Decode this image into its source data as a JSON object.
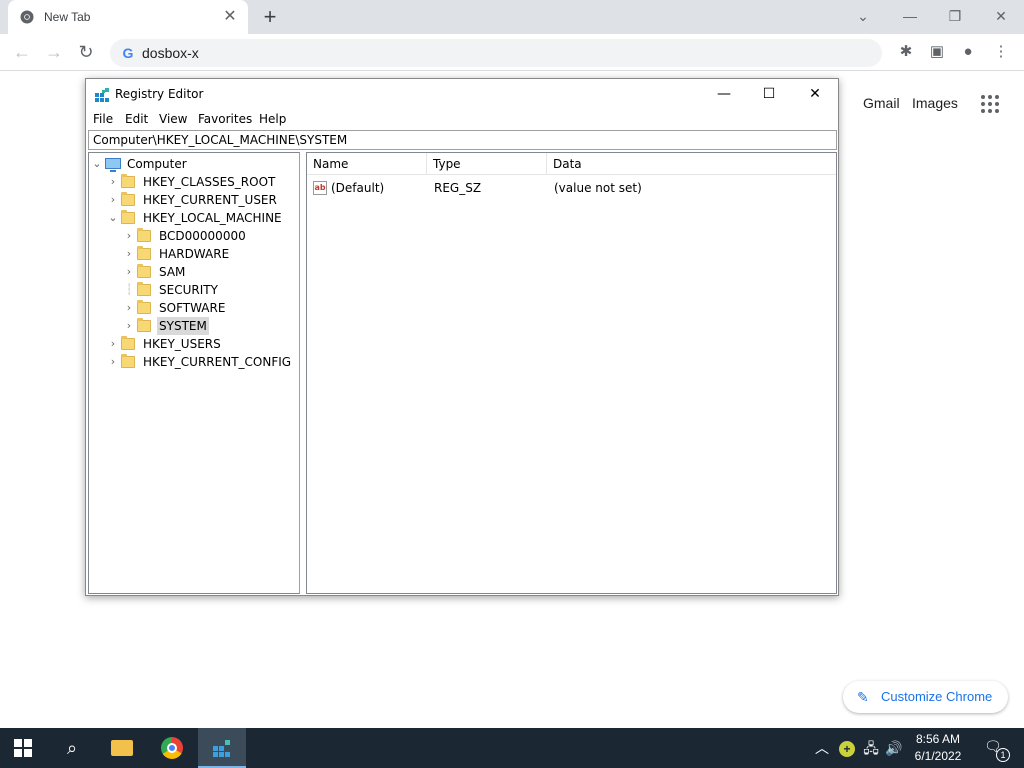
{
  "browser": {
    "tab": {
      "title": "New Tab"
    },
    "url": "dosbox-x"
  },
  "ntp": {
    "links": [
      "Gmail",
      "Images"
    ],
    "customize_label": "Customize Chrome"
  },
  "regedit": {
    "title": "Registry Editor",
    "menu": [
      "File",
      "Edit",
      "View",
      "Favorites",
      "Help"
    ],
    "address": "Computer\\HKEY_LOCAL_MACHINE\\SYSTEM",
    "tree": [
      {
        "label": "Computer",
        "level": 0,
        "expander": "open",
        "icon": "computer-icon"
      },
      {
        "label": "HKEY_CLASSES_ROOT",
        "level": 1,
        "expander": "closed",
        "icon": "folder-icon"
      },
      {
        "label": "HKEY_CURRENT_USER",
        "level": 1,
        "expander": "closed",
        "icon": "folder-icon"
      },
      {
        "label": "HKEY_LOCAL_MACHINE",
        "level": 1,
        "expander": "open",
        "icon": "folder-icon"
      },
      {
        "label": "BCD00000000",
        "level": 2,
        "expander": "closed",
        "icon": "folder-icon"
      },
      {
        "label": "HARDWARE",
        "level": 2,
        "expander": "closed",
        "icon": "folder-icon"
      },
      {
        "label": "SAM",
        "level": 2,
        "expander": "closed",
        "icon": "folder-icon"
      },
      {
        "label": "SECURITY",
        "level": 2,
        "expander": "none",
        "icon": "folder-icon"
      },
      {
        "label": "SOFTWARE",
        "level": 2,
        "expander": "closed",
        "icon": "folder-icon"
      },
      {
        "label": "SYSTEM",
        "level": 2,
        "expander": "closed",
        "icon": "folder-icon",
        "selected": true
      },
      {
        "label": "HKEY_USERS",
        "level": 1,
        "expander": "closed",
        "icon": "folder-icon"
      },
      {
        "label": "HKEY_CURRENT_CONFIG",
        "level": 1,
        "expander": "closed",
        "icon": "folder-icon"
      }
    ],
    "columns": [
      "Name",
      "Type",
      "Data"
    ],
    "values": [
      {
        "name": "(Default)",
        "type": "REG_SZ",
        "data": "(value not set)",
        "icon": "string-value-icon"
      }
    ]
  },
  "taskbar": {
    "time": "8:56 AM",
    "date": "6/1/2022",
    "notification_count": "1"
  }
}
